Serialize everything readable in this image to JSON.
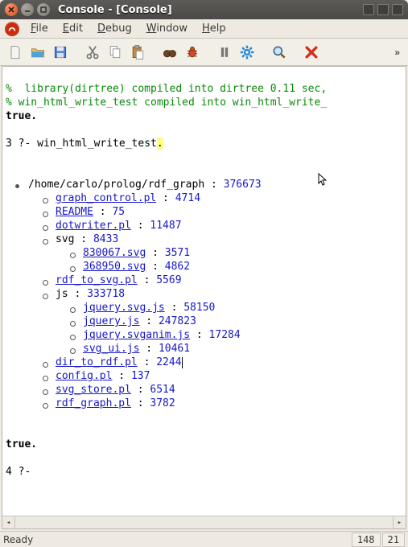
{
  "window": {
    "title": "Console - [Console]"
  },
  "menu": {
    "items": [
      "File",
      "Edit",
      "Debug",
      "Window",
      "Help"
    ]
  },
  "toolbar": {
    "icons": [
      "new-file-icon",
      "open-file-icon",
      "save-icon",
      "cut-icon",
      "copy-icon",
      "paste-icon",
      "binoculars-icon",
      "bug-icon",
      "pause-icon",
      "gear-icon",
      "magnifier-icon",
      "cancel-icon"
    ]
  },
  "console": {
    "line1_pre": "%  library(dirtree) compiled into dirtree 0.11 sec,",
    "line2_pre": "% win_html_write_test compiled into win_html_write_",
    "true1": "true.",
    "prompt3_num": "3 ?- ",
    "prompt3_cmd": "win_html_write_test",
    "prompt3_dot": ".",
    "root_label": "/home/carlo/prolog/rdf_graph",
    "root_size": "376673",
    "children": [
      {
        "label": "graph_control.pl",
        "size": "4714",
        "link": true
      },
      {
        "label": "README",
        "size": "75",
        "link": true
      },
      {
        "label": "dotwriter.pl",
        "size": "11487",
        "link": true
      },
      {
        "label": "svg",
        "size": "8433",
        "link": false,
        "children": [
          {
            "label": "830067.svg",
            "size": "3571",
            "link": true
          },
          {
            "label": "368950.svg",
            "size": "4862",
            "link": true
          }
        ]
      },
      {
        "label": "rdf_to_svg.pl",
        "size": "5569",
        "link": true
      },
      {
        "label": "js",
        "size": "333718",
        "link": false,
        "children": [
          {
            "label": "jquery.svg.js",
            "size": "58150",
            "link": true
          },
          {
            "label": "jquery.js",
            "size": "247823",
            "link": true
          },
          {
            "label": "jquery.svganim.js",
            "size": "17284",
            "link": true
          },
          {
            "label": "svg_ui.js",
            "size": "10461",
            "link": true
          }
        ]
      },
      {
        "label": "dir_to_rdf.pl",
        "size": "2244",
        "link": true,
        "caret": true
      },
      {
        "label": "config.pl",
        "size": "137",
        "link": true
      },
      {
        "label": "svg_store.pl",
        "size": "6514",
        "link": true
      },
      {
        "label": "rdf_graph.pl",
        "size": "3782",
        "link": true
      }
    ],
    "true2": "true.",
    "prompt4": "4 ?- "
  },
  "status": {
    "text": "Ready",
    "line": "148",
    "col": "21"
  },
  "sep": " : "
}
